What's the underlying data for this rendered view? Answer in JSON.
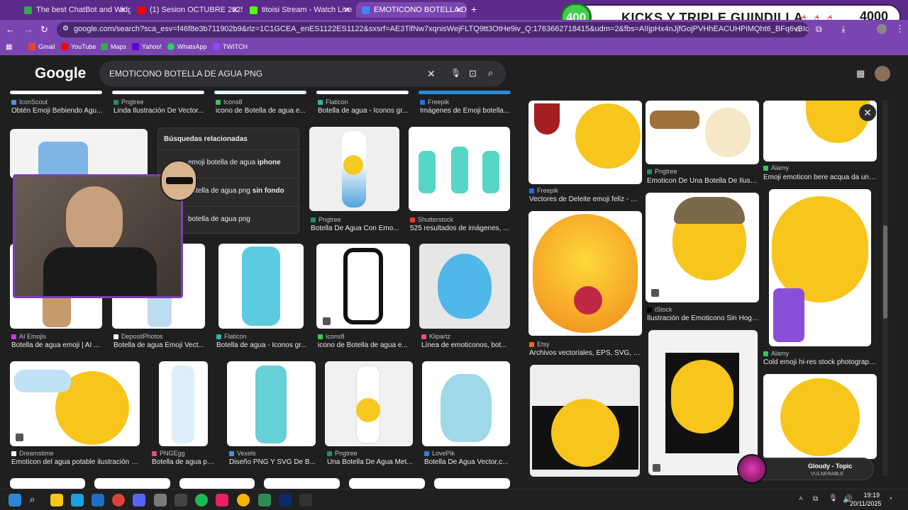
{
  "tabs": [
    {
      "label": "The best ChatBot and Widgets",
      "color": "#34a853"
    },
    {
      "label": "(1) Sesion OCTUBRE 2025 I",
      "color": "#ff0000"
    },
    {
      "label": "titoisi Stream - Watch Live on K",
      "color": "#53fc18"
    },
    {
      "label": "EMOTICONO BOTELLA DE AGU",
      "color": "#4285f4"
    }
  ],
  "url": "google.com/search?sca_esv=f46f8e3b711902b9&rlz=1C1GCEA_enES1122ES1122&sxsrf=AE3TifNw7xqnisWejFLTQ9tt3OtHe9iv_Q:1763662718415&udm=2&fbs=AIIjpHx4nJjfGojPVHhEACUHPiMQht6_BFq6vBIoFFRK7qchKMWHHr0OYuKgilbt...",
  "bookmarks": [
    "Gmail",
    "YouTube",
    "Maps",
    "Yahoo!",
    "WhatsApp",
    "TWITCH"
  ],
  "overlay": {
    "left_count": "400",
    "title": "KICKS Y TRIPLE GUINDILLA",
    "right_count": "4000"
  },
  "google": {
    "logo": "Google",
    "query": "EMOTICONO BOTELLA DE AGUA PNG"
  },
  "related": {
    "title": "Búsquedas relacionadas",
    "items": [
      {
        "a": "emoji botella de agua ",
        "b": "iphone"
      },
      {
        "a": "botella de agua png ",
        "b": "sin fondo"
      },
      {
        "a": "botella de agua png",
        "b": ""
      }
    ]
  },
  "results_row0": [
    {
      "src": "IconScout",
      "cap": "Obtén Emoji Bebiendo Agu..."
    },
    {
      "src": "Pngtree",
      "cap": "Linda Ilustración De Vector..."
    },
    {
      "src": "Icons8",
      "cap": "icono de Botella de agua e..."
    },
    {
      "src": "Flaticon",
      "cap": "Botella de agua - Iconos gr..."
    },
    {
      "src": "Freepik",
      "cap": "Imágenes de Emoji botella..."
    }
  ],
  "results_row1": [
    {
      "src": "Pngtree",
      "cap": "Botella De Agua Con Emo..."
    },
    {
      "src": "Shutterstock",
      "cap": "525 resultados de imágenes, ..."
    }
  ],
  "results_row2": [
    {
      "src": "AI Emojis",
      "cap": "Botella de agua emoji | AI ..."
    },
    {
      "src": "DepositPhotos",
      "cap": "Botella de agua Emoji Vect..."
    },
    {
      "src": "Flaticon",
      "cap": "Botella de agua - Iconos gr..."
    },
    {
      "src": "Icons8",
      "cap": "icono de Botella de agua e..."
    },
    {
      "src": "Klipartz",
      "cap": "Línea de emoticonos, bot..."
    }
  ],
  "results_row3": [
    {
      "src": "Dreamstime",
      "cap": "Emoticon del agua potable ilustración d..."
    },
    {
      "src": "PNGEgg",
      "cap": "Botella de agua pn..."
    },
    {
      "src": "Vexels",
      "cap": "Diseño PNG Y SVG De B..."
    },
    {
      "src": "Pngtree",
      "cap": "Una Botella De Agua Met..."
    },
    {
      "src": "LovePik",
      "cap": "Botella De Agua Vector,c..."
    }
  ],
  "right_panel": [
    {
      "src": "Freepik",
      "cap": "Vectores de Deleite emoji feliz - De..."
    },
    {
      "src": "Pngtree",
      "cap": "Emoticon De Una Botella De Ilustr..."
    },
    {
      "src": "Alamy",
      "cap": "Emoji emoticon bere acqua da una..."
    },
    {
      "src": "Etsy",
      "cap": "Archivos vectoriales, EPS, SVG, P..."
    },
    {
      "src": "iStock",
      "cap": "Ilustración de Emoticono Sin Hoga..."
    },
    {
      "src": "Alamy",
      "cap": "Cold emoji hi-res stock photograph..."
    }
  ],
  "nowplaying": {
    "title": "Gloudy - Topic",
    "subtitle": "VULNERABLE"
  },
  "clock": {
    "time": "19:19",
    "date": "20/11/2025"
  }
}
